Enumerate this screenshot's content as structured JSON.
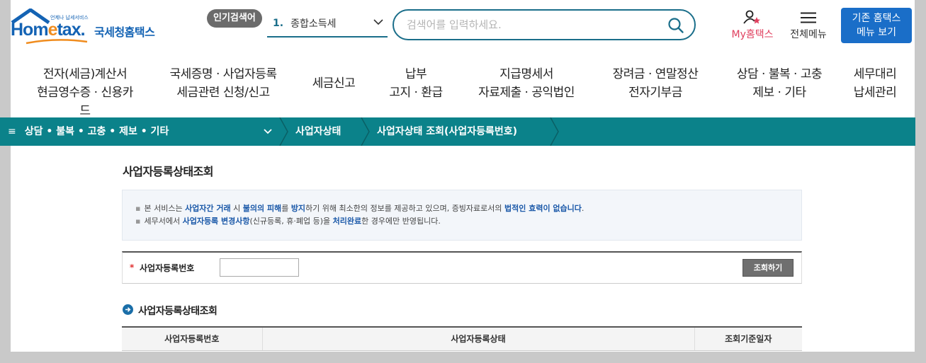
{
  "header": {
    "logo_tagline": "언제나 납세서비스",
    "logo_word_a": "Hom",
    "logo_word_e": "e",
    "logo_word_b": "tax.",
    "logo_kr": "국세청홈택스",
    "popular_badge": "인기검색어",
    "popular_rank": "1.",
    "popular_term": "종합소득세",
    "search_placeholder": "검색어를 입력하세요.",
    "my_hometax": "My홈택스",
    "all_menu": "전체메뉴",
    "legacy_line1": "기존 홈택스",
    "legacy_line2": "메뉴 보기"
  },
  "gnb": [
    {
      "l1": "전자(세금)계산서",
      "l2": "현금영수증 · 신용카드"
    },
    {
      "l1": "국세증명 · 사업자등록",
      "l2": "세금관련 신청/신고"
    },
    {
      "l1": "세금신고",
      "l2": ""
    },
    {
      "l1": "납부",
      "l2": "고지 · 환급"
    },
    {
      "l1": "지급명세서",
      "l2": "자료제출 · 공익법인"
    },
    {
      "l1": "장려금 · 연말정산",
      "l2": "전자기부금"
    },
    {
      "l1": "상담 · 불복 · 고충",
      "l2": "제보 · 기타"
    },
    {
      "l1": "세무대리",
      "l2": "납세관리"
    }
  ],
  "breadcrumb": {
    "menu_label": "상담 • 불복 • 고충 • 제보 • 기타",
    "level2": "사업자상태",
    "level3": "사업자상태 조회(사업자등록번호)"
  },
  "page": {
    "title": "사업자등록상태조회",
    "notice1": {
      "a": "본 서비스는 ",
      "b": "사업자간 거래",
      "c": " 시 ",
      "d": "불의의 피해",
      "e": "를 ",
      "f": "방지",
      "g": "하기 위해 최소한의 정보를 제공하고 있으며, 증빙자료로서의 ",
      "h": "법적인 효력이 없습니다",
      "i": "."
    },
    "notice2": {
      "a": "세무서에서 ",
      "b": "사업자등록 변경사항",
      "c": "(신규등록, 휴·폐업 등)을 ",
      "d": "처리완료",
      "e": "한 경우에만 반영됩니다."
    },
    "form": {
      "required_mark": "*",
      "label": "사업자등록번호",
      "input_value": "",
      "button": "조회하기"
    },
    "section_title": "사업자등록상태조회",
    "table_headers": [
      "사업자등록번호",
      "사업자등록상태",
      "조회기준일자"
    ]
  }
}
